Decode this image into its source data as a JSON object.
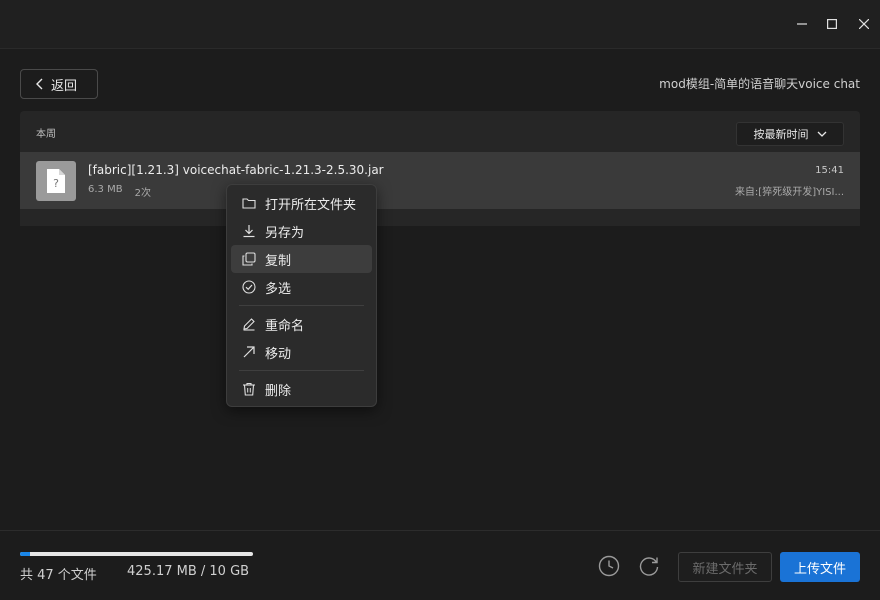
{
  "window": {
    "minimize_icon": "minimize-icon",
    "maximize_icon": "maximize-icon",
    "close_icon": "close-icon"
  },
  "header": {
    "back_label": "返回",
    "title": "mod模组-简单的语音聊天voice chat"
  },
  "list": {
    "group_label": "本周",
    "sort_label": "按最新时间",
    "files": [
      {
        "name": "[fabric][1.21.3] voicechat-fabric-1.21.3-2.5.30.jar",
        "size": "6.3 MB",
        "count": "2次",
        "time": "15:41",
        "source": "来自:[猝死级开发]YISI..."
      }
    ]
  },
  "context_menu": {
    "items": [
      {
        "label": "打开所在文件夹",
        "icon": "folder-icon"
      },
      {
        "label": "另存为",
        "icon": "download-icon"
      },
      {
        "label": "复制",
        "icon": "copy-icon"
      },
      {
        "label": "多选",
        "icon": "check-circle-icon"
      },
      {
        "label": "重命名",
        "icon": "pencil-icon"
      },
      {
        "label": "移动",
        "icon": "arrow-up-right-icon"
      },
      {
        "label": "删除",
        "icon": "trash-icon"
      }
    ]
  },
  "footer": {
    "file_count": "共 47 个文件",
    "storage": "425.17 MB / 10 GB",
    "storage_used_fraction": 0.0415,
    "new_folder_label": "新建文件夹",
    "upload_label": "上传文件"
  },
  "colors": {
    "accent": "#1a73d6",
    "progress": "#1a86e8"
  }
}
